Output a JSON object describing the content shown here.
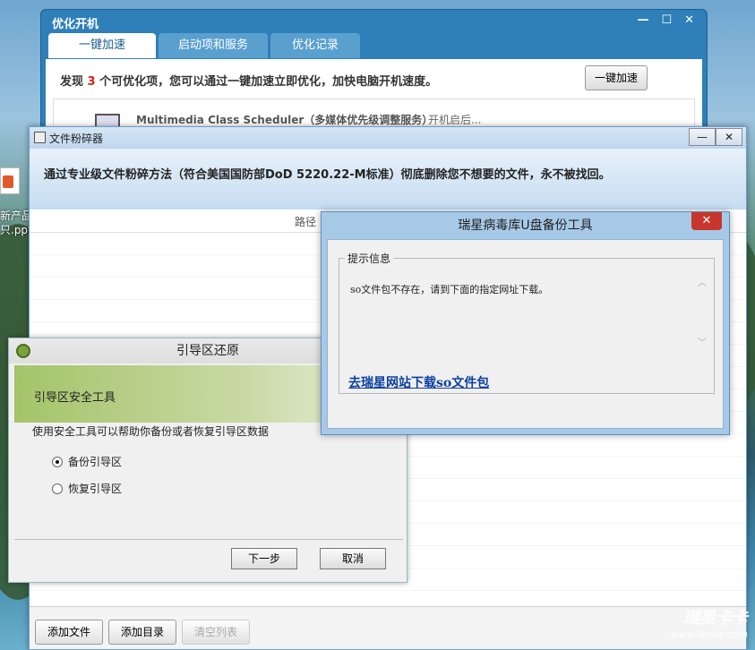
{
  "desktop": {
    "icon_label_line1": "新产品型",
    "icon_label_line2": "只.ppt"
  },
  "boot": {
    "title": "优化开机",
    "tabs": [
      "一键加速",
      "启动项和服务",
      "优化记录"
    ],
    "found_prefix": "发现 ",
    "found_count": "3",
    "found_suffix": " 个可优化项，您可以通过一键加速立即优化，加快电脑开机速度。",
    "accelerate_button": "一键加速",
    "item_service": "Multimedia Class Scheduler（多媒体优先级调整服务）",
    "item_state": "开机启后..."
  },
  "shredder": {
    "title": "文件粉碎器",
    "header": "通过专业级文件粉碎方法（符合美国国防部DoD 5220.22-M标准）彻底删除您不想要的文件，永不被找回。",
    "column_path": "路径",
    "buttons": {
      "add_file": "添加文件",
      "add_dir": "添加目录",
      "clear": "清空列表"
    }
  },
  "bootsector": {
    "title": "引导区还原",
    "banner": "引导区安全工具",
    "description": "使用安全工具可以帮助你备份或者恢复引导区数据",
    "options": [
      "备份引导区",
      "恢复引导区"
    ],
    "next": "下一步",
    "cancel": "取消"
  },
  "usb_tool": {
    "title": "瑞星病毒库U盘备份工具",
    "close": "✕",
    "group_label": "提示信息",
    "message": "so文件包不存在，请到下面的指定网址下载。",
    "link": "去瑞星网站下载so文件包"
  },
  "watermark": {
    "brand": "瑞星卡卡",
    "url": "www.ikaka.com"
  }
}
